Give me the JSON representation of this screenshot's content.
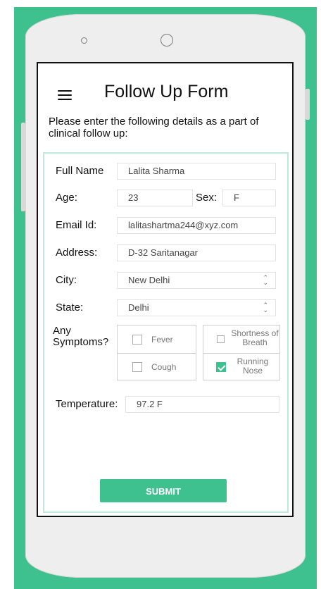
{
  "header": {
    "title": "Follow Up Form",
    "menu_icon": "hamburger-menu-icon"
  },
  "intro": "Please enter the following details as a part of clinical follow up:",
  "form": {
    "full_name": {
      "label": "Full Name",
      "value": "Lalita Sharma"
    },
    "age": {
      "label": "Age:",
      "value": "23"
    },
    "sex": {
      "label": "Sex:",
      "value": "F"
    },
    "email": {
      "label": "Email Id:",
      "value": "lalitashartma244@xyz.com"
    },
    "address": {
      "label": "Address:",
      "value": "D-32 Saritanagar"
    },
    "city": {
      "label": "City:",
      "value": "New Delhi"
    },
    "state": {
      "label": "State:",
      "value": "Delhi"
    },
    "symptoms": {
      "label": "Any Symptoms?",
      "options": [
        {
          "label": "Fever",
          "checked": false
        },
        {
          "label": "Cough",
          "checked": false
        },
        {
          "label": "Shortness of Breath",
          "checked": false
        },
        {
          "label": "Running Nose",
          "checked": true
        }
      ]
    },
    "temperature": {
      "label": "Temperature:",
      "value": "97.2 F"
    },
    "submit_label": "SUBMIT"
  },
  "colors": {
    "accent": "#3ec08f",
    "form_border": "#bfe9d8"
  }
}
